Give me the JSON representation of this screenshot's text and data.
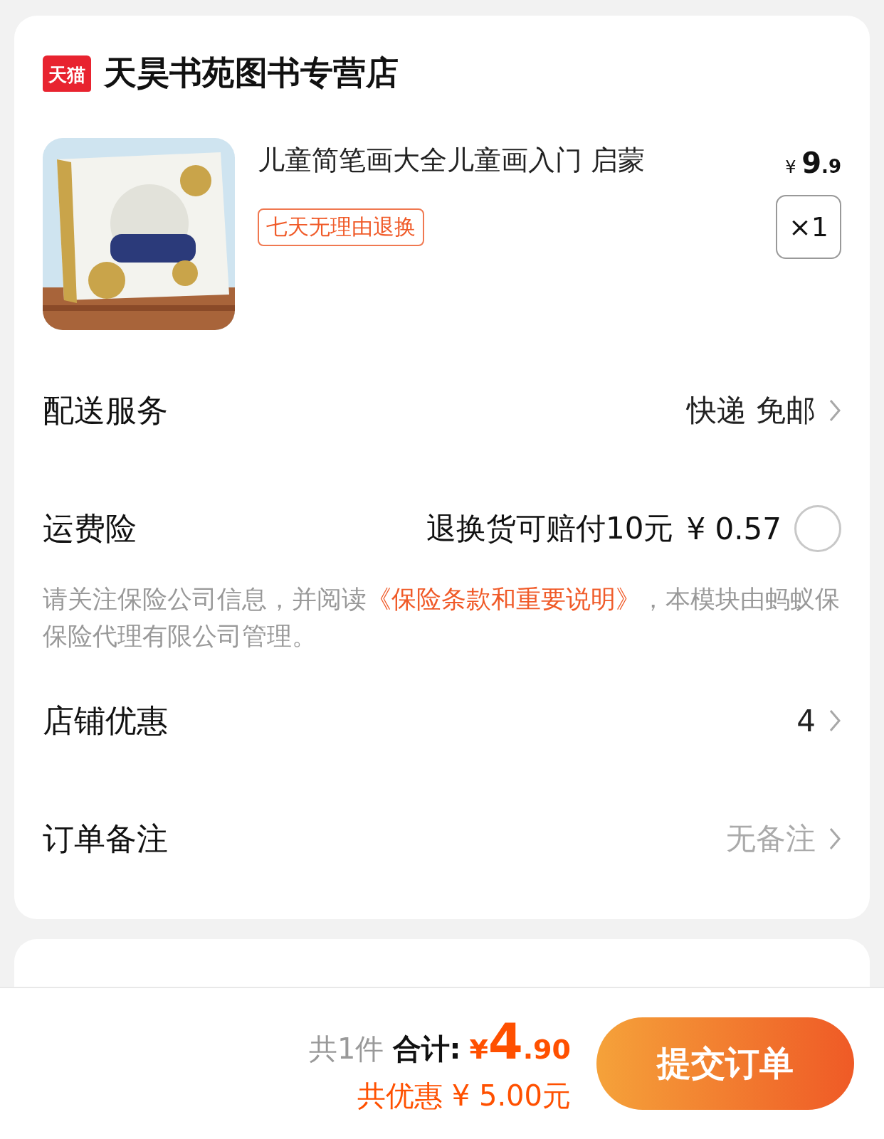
{
  "store": {
    "badge": "天猫",
    "name": "天昊书苑图书专营店"
  },
  "product": {
    "title": "儿童简笔画大全儿童画入门 启蒙",
    "price_symbol": "¥",
    "price_int": "9",
    "price_dec": ".9",
    "quantity": "×1",
    "tag": "七天无理由退换"
  },
  "rows": [
    {
      "kind": "link",
      "label": "配送服务",
      "value": "快递 免邮",
      "muted": false
    },
    {
      "kind": "insurance",
      "label": "运费险",
      "value": "退换货可赔付10元",
      "price": "¥ 0.57",
      "checked": false
    },
    {
      "kind": "note",
      "text": "请关注保险公司信息，并阅读",
      "link": "《保险条款和重要说明》",
      "text_after": "，本模块由蚂蚁保保险代理有限公司管理。"
    },
    {
      "kind": "link",
      "label": "店铺优惠",
      "value": "4",
      "muted": false
    },
    {
      "kind": "link",
      "label": "订单备注",
      "value": "无备注",
      "muted": true
    }
  ],
  "footer": {
    "count": "共1件",
    "total_label": "合计:",
    "currency": "¥",
    "total_int": "4",
    "total_dec": ".90",
    "discount": "共优惠 ¥ 5.00元",
    "submit": "提交订单"
  }
}
